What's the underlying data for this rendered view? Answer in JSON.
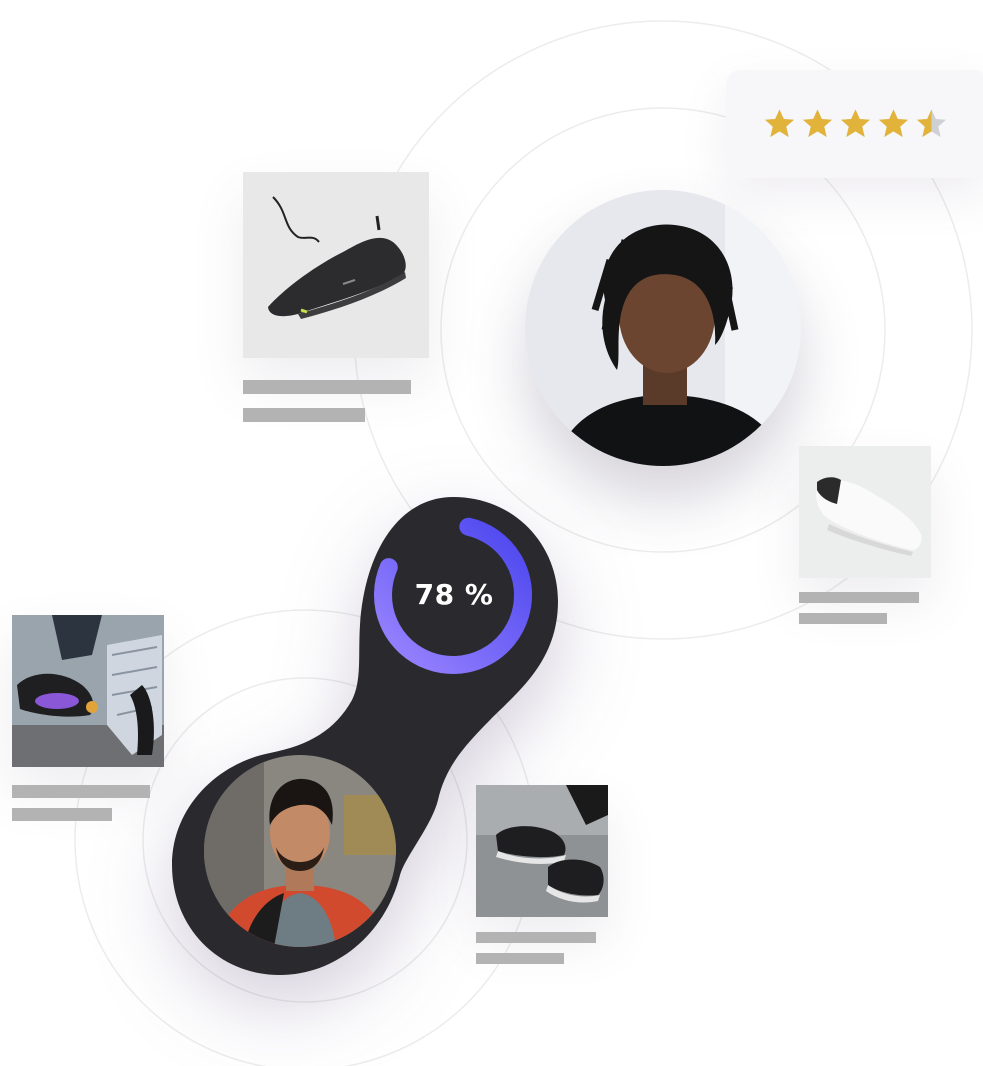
{
  "rating": {
    "stars": 5,
    "value": 4.5
  },
  "progress": {
    "value": 78,
    "label": "78 %"
  },
  "colors": {
    "accent_start": "#8f79ff",
    "accent_end": "#4f4aef",
    "star_gold": "#e2b33b",
    "star_grey": "#cfd0d4",
    "dark_card": "#2a2a2e",
    "placeholder_bar": "#b3b3b3"
  },
  "cards": [
    {
      "name": "black-runner-shoe",
      "icon": "shoe-image"
    },
    {
      "name": "white-sneaker",
      "icon": "shoe-image"
    },
    {
      "name": "purple-trainer",
      "icon": "shoe-image"
    },
    {
      "name": "black-high-top",
      "icon": "shoe-image"
    }
  ],
  "avatars": [
    {
      "name": "man-with-dreadlocks"
    },
    {
      "name": "man-in-red-jacket"
    }
  ]
}
